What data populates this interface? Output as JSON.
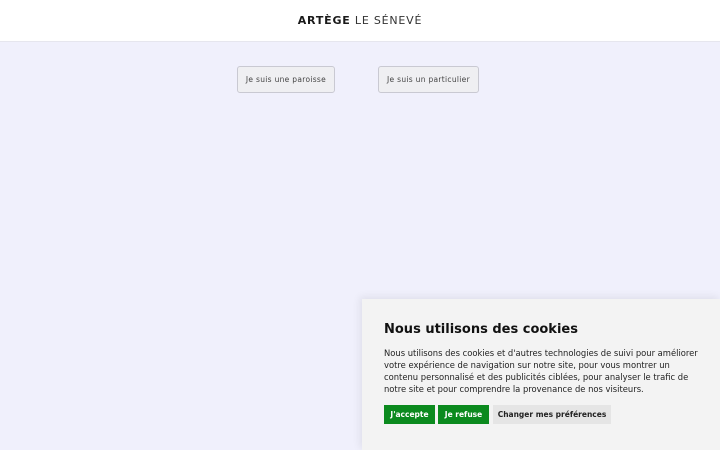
{
  "header": {
    "logo_bold": "ARTÈGE",
    "logo_light": "LE SÉNEVÉ"
  },
  "choices": {
    "paroisse": "Je suis une paroisse",
    "particulier": "Je suis un particulier"
  },
  "cookie_banner": {
    "title": "Nous utilisons des cookies",
    "text": "Nous utilisons des cookies et d'autres technologies de suivi pour améliorer votre expérience de navigation sur notre site, pour vous montrer un contenu personnalisé et des publicités ciblées, pour analyser le trafic de notre site et pour comprendre la provenance de nos visiteurs.",
    "accept_label": "J'accepte",
    "refuse_label": "Je refuse",
    "preferences_label": "Changer mes préférences"
  },
  "colors": {
    "page_background": "#f0f0fc",
    "accept_button": "#0b8a1e",
    "banner_background": "#f3f3f3"
  }
}
